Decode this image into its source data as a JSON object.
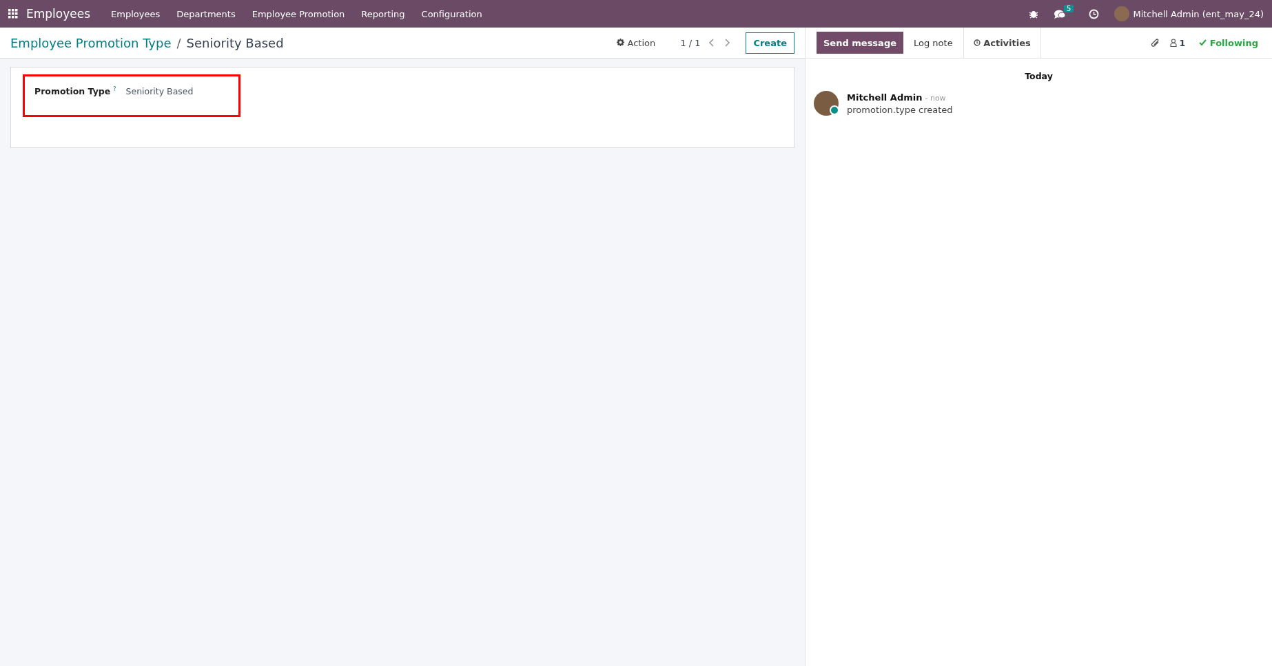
{
  "navbar": {
    "app_name": "Employees",
    "menu": [
      {
        "label": "Employees"
      },
      {
        "label": "Departments"
      },
      {
        "label": "Employee Promotion"
      },
      {
        "label": "Reporting"
      },
      {
        "label": "Configuration"
      }
    ],
    "messages_count": "5",
    "user": "Mitchell Admin (ent_may_24)"
  },
  "control_panel": {
    "breadcrumb_separator": "/",
    "breadcrumb": [
      {
        "label": "Employee Promotion Type",
        "current": false
      },
      {
        "label": "Seniority Based",
        "current": true
      }
    ],
    "action": "Action",
    "pager": "1 / 1",
    "create": "Create"
  },
  "form": {
    "fields": [
      {
        "label": "Promotion Type",
        "help": "?",
        "value": "Seniority Based",
        "highlighted": true
      }
    ]
  },
  "chatter": {
    "buttons": [
      {
        "label": "Send message",
        "kind": "primary"
      },
      {
        "label": "Log note",
        "kind": "plain"
      },
      {
        "label": "Activities",
        "kind": "activities"
      }
    ],
    "followers": "1",
    "following": true,
    "follow_label": "Following",
    "date_separator": "Today",
    "messages": [
      {
        "author": "Mitchell Admin",
        "time": "- now",
        "body": "promotion.type created",
        "online": true
      }
    ]
  }
}
